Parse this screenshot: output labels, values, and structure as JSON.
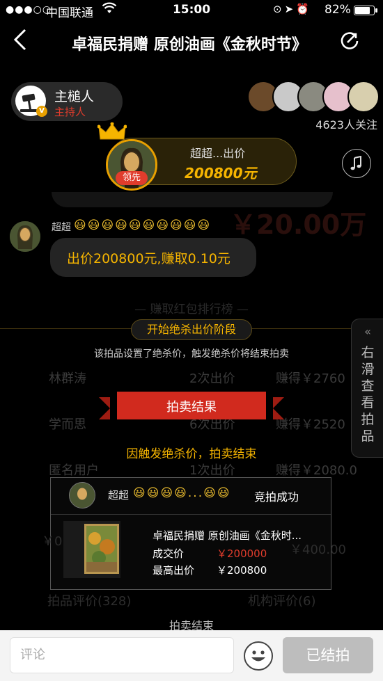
{
  "status_bar": {
    "signal": "●●●○○",
    "carrier": "中国联通",
    "time": "15:00",
    "battery": "82%",
    "battery_level": 0.82
  },
  "nav": {
    "back_label": "<",
    "title": "卓福民捐赠 原创油画《金秋时节》"
  },
  "host": {
    "name": "主槌人",
    "role": "主持人",
    "badge": "V"
  },
  "followers": {
    "count_label": "4623人关注"
  },
  "leader": {
    "name_line": "超超...出价",
    "amount": "200800元",
    "tag": "领先"
  },
  "bid_message": {
    "user": "超超",
    "emojis": "😃😃😃😃😃😃😃😃😃😃",
    "text": "出价200800元,赚取0.10元"
  },
  "ghost_text": {
    "price": "￥20.00万",
    "rank_title": "— 赚取红包排行榜 —",
    "rows": [
      {
        "name": "林群涛",
        "count": "2次出价",
        "earn": "赚得￥2760"
      },
      {
        "name": "学而思",
        "count": "6次出价",
        "earn": "赚得￥2520"
      },
      {
        "name": "匿名用户",
        "count": "1次出价",
        "earn": "赚得￥2080.0"
      }
    ],
    "reviews_left": "拍品评价(328)",
    "reviews_right": "机构评价(6)",
    "price_left": "￥0",
    "price_right": "￥400.00"
  },
  "phase": {
    "label": "开始绝杀出价阶段",
    "note": "该拍品设置了绝杀价，触发绝杀价将结束拍卖"
  },
  "side_tab": {
    "arrow": "«",
    "text": "右滑查看拍品"
  },
  "result": {
    "banner": "拍卖结果",
    "reason": "因触发绝杀价，拍卖结束",
    "winner": "超超",
    "winner_emojis": "😃😃😃😃...😃😃",
    "status": "竞拍成功",
    "item_title": "卓福民捐赠 原创油画《金秋时...",
    "deal_price_label": "成交价",
    "deal_price": "￥200000",
    "high_bid_label": "最高出价",
    "high_bid": "￥200800"
  },
  "footer": {
    "end_label": "拍卖结束",
    "comment_placeholder": "评论",
    "end_button": "已结拍"
  },
  "colors": {
    "accent_gold": "#f5b400",
    "accent_red": "#e03c2c"
  }
}
